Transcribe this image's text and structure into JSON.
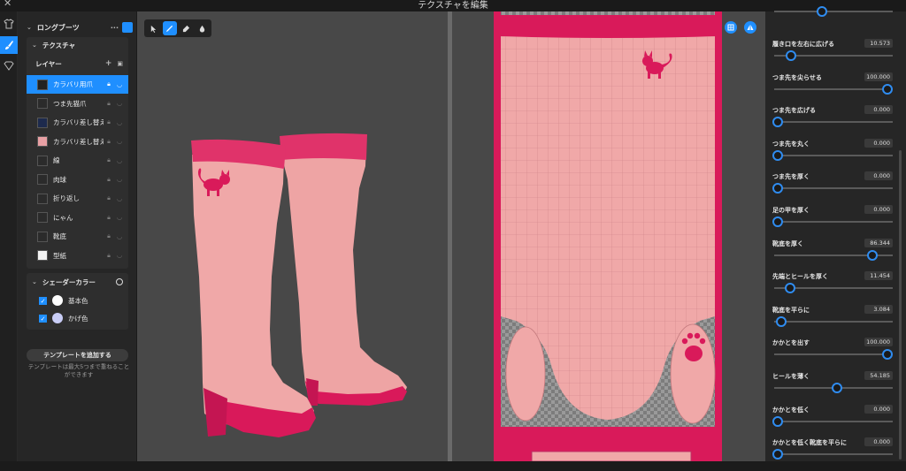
{
  "window": {
    "title": "テクスチャを編集"
  },
  "left_panel": {
    "item_title": "ロングブーツ",
    "texture_section": "テクスチャ",
    "layers_label": "レイヤー",
    "layers": [
      {
        "name": "カラバリ用爪",
        "selected": true,
        "thumb": "#232323"
      },
      {
        "name": "つま先猫爪",
        "selected": false,
        "thumb": "#2b2b2b"
      },
      {
        "name": "カラバリ差し替え(コピー)",
        "selected": false,
        "thumb": "#1d2a4d"
      },
      {
        "name": "カラバリ差し替え",
        "selected": false,
        "thumb": "#e8a0a4"
      },
      {
        "name": "線",
        "selected": false,
        "thumb": "#2b2b2b"
      },
      {
        "name": "肉球",
        "selected": false,
        "thumb": "#2b2b2b"
      },
      {
        "name": "折り返し",
        "selected": false,
        "thumb": "#2b2b2b"
      },
      {
        "name": "にゃん",
        "selected": false,
        "thumb": "#2b2b2b"
      },
      {
        "name": "靴底",
        "selected": false,
        "thumb": "#2b2b2b"
      },
      {
        "name": "型紙",
        "selected": false,
        "thumb": "#f2f2f2"
      }
    ],
    "shader_section": "シェーダーカラー",
    "shader_colors": [
      {
        "name": "基本色",
        "color": "#ffffff",
        "checked": true
      },
      {
        "name": "かげ色",
        "color": "#c9cdf6",
        "checked": true
      }
    ],
    "add_template_button": "テンプレートを追加する",
    "template_note": "テンプレートは最大5つまで重ねることができます"
  },
  "toolbar": {
    "tools": [
      {
        "icon": "cursor-icon",
        "active": false
      },
      {
        "icon": "pen-icon",
        "active": true
      },
      {
        "icon": "eraser-icon",
        "active": false
      },
      {
        "icon": "dropper-icon",
        "active": false
      }
    ]
  },
  "colors": {
    "accent": "#1f8fff",
    "boot_pink": "#f0a8a8",
    "boot_magenta": "#d91a5a",
    "panel_bg": "#262626",
    "viewport_bg": "#484848"
  },
  "params": [
    {
      "label": "履き口を左右に広げる",
      "value": "10.573",
      "level": 0.12
    },
    {
      "label": "つま先を尖らせる",
      "value": "100.000",
      "level": 1.0
    },
    {
      "label": "つま先を広げる",
      "value": "0.000",
      "level": 0.0
    },
    {
      "label": "つま先を丸く",
      "value": "0.000",
      "level": 0.0
    },
    {
      "label": "つま先を厚く",
      "value": "0.000",
      "level": 0.0
    },
    {
      "label": "足の甲を厚く",
      "value": "0.000",
      "level": 0.0
    },
    {
      "label": "靴底を厚く",
      "value": "86.344",
      "level": 0.86
    },
    {
      "label": "先端とヒールを厚く",
      "value": "11.454",
      "level": 0.11
    },
    {
      "label": "靴底を平らに",
      "value": "3.084",
      "level": 0.03
    },
    {
      "label": "かかとを出す",
      "value": "100.000",
      "level": 1.0
    },
    {
      "label": "ヒールを薄く",
      "value": "54.185",
      "level": 0.54
    },
    {
      "label": "かかとを低く",
      "value": "0.000",
      "level": 0.0
    },
    {
      "label": "かかとを低く靴底を平らに",
      "value": "0.000",
      "level": 0.0
    }
  ],
  "top_param_partial": {
    "level": 0.4
  }
}
